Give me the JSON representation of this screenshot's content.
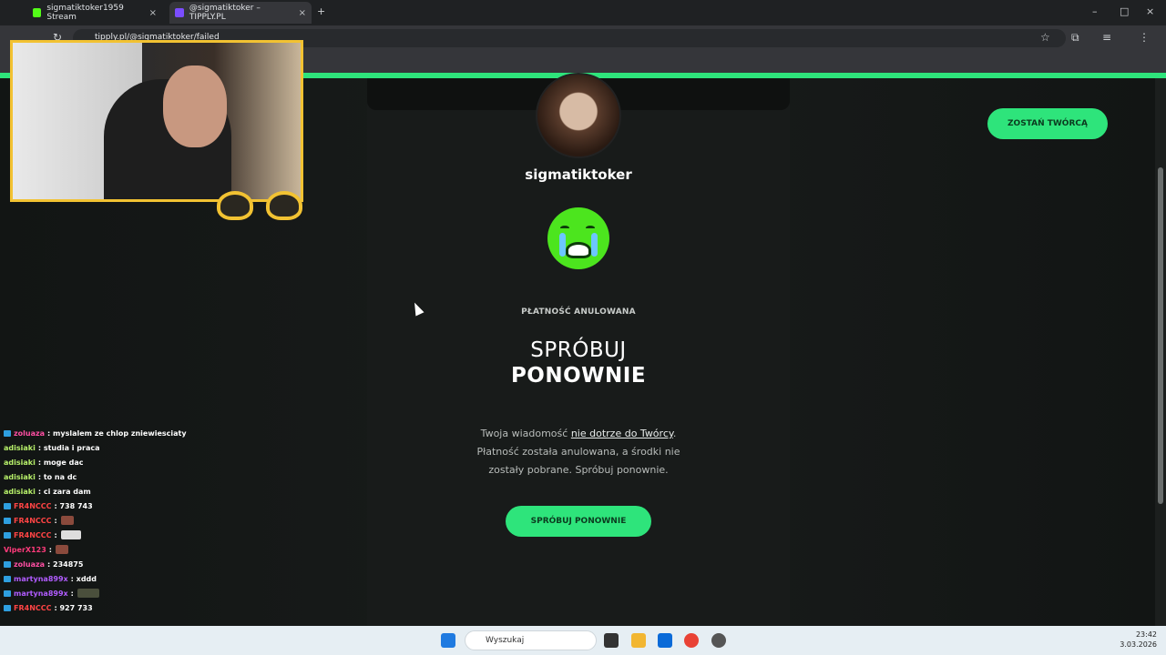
{
  "browser": {
    "tabs": [
      {
        "label": "sigmatiktoker1959 Stream"
      },
      {
        "label": "@sigmatiktoker – TIPPLY.PL"
      }
    ],
    "url": "tipply.pl/@sigmatiktoker/failed"
  },
  "page": {
    "username": "sigmatiktoker",
    "status": "PŁATNOŚĆ ANULOWANA",
    "heading_line1": "SPRÓBUJ",
    "heading_line2": "PONOWNIE",
    "message_pre": "Twoja wiadomość ",
    "message_link": "nie dotrze do Twórcy",
    "message_post": ". Płatność została anulowana, a środki nie zostały pobrane. Spróbuj ponownie.",
    "retry_label": "SPRÓBUJ PONOWNIE",
    "creator_label": "ZOSTAŃ TWÓRCĄ"
  },
  "chat": [
    {
      "user": "zoluaza",
      "text": ": myslalem ze chlop zniewiesciaty",
      "color": "#ff4fa3",
      "badge": true
    },
    {
      "user": "adisiaki",
      "text": ": studia i praca",
      "color": "#b7f06a",
      "badge": false
    },
    {
      "user": "adisiaki",
      "text": ": moge dac",
      "color": "#b7f06a",
      "badge": false
    },
    {
      "user": "adisiaki",
      "text": ": to na dc",
      "color": "#b7f06a",
      "badge": false
    },
    {
      "user": "adisiaki",
      "text": ": ci zara dam",
      "color": "#b7f06a",
      "badge": false
    },
    {
      "user": "FR4NCCC",
      "text": ": 738 743",
      "color": "#ff4444",
      "badge": true
    },
    {
      "user": "FR4NCCC",
      "text": ":",
      "color": "#ff4444",
      "badge": true,
      "emote": "normal"
    },
    {
      "user": "FR4NCCC",
      "text": ":",
      "color": "#ff4444",
      "badge": true,
      "emote": "wide"
    },
    {
      "user": "ViperX123",
      "text": ":",
      "color": "#ff3b7b",
      "badge": false,
      "emote": "normal"
    },
    {
      "user": "zoluaza",
      "text": ": 234875",
      "color": "#ff4fa3",
      "badge": true
    },
    {
      "user": "martyna899x",
      "text": ": xddd",
      "color": "#b15cff",
      "badge": true
    },
    {
      "user": "martyna899x",
      "text": ":",
      "color": "#b15cff",
      "badge": true,
      "emote": "tank"
    },
    {
      "user": "FR4NCCC",
      "text": ": 927 733",
      "color": "#ff4444",
      "badge": true
    }
  ],
  "taskbar": {
    "search_placeholder": "Wyszukaj",
    "time": "23:42",
    "date": "3.03.2026"
  },
  "colors": {
    "accent": "#2ee47b",
    "webcam_border": "#f2c232"
  }
}
